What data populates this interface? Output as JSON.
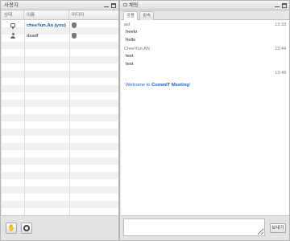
{
  "users_panel": {
    "title": "사용자",
    "columns": [
      "상태",
      "이름",
      "미디어"
    ],
    "users": [
      {
        "name": "cheeYun.An (you)",
        "status_icon": "monitor-icon",
        "media_icon": "shield-icon",
        "is_self": true
      },
      {
        "name": "daadf",
        "status_icon": "person-icon",
        "media_icon": "shield-icon",
        "is_self": false
      }
    ],
    "bottom_buttons": [
      {
        "icon": "hand-icon",
        "glyph": "✋"
      },
      {
        "icon": "gear-icon"
      }
    ]
  },
  "chat_panel": {
    "title": "채팅",
    "tabs": [
      {
        "label": "공용",
        "active": true
      },
      {
        "label": "귓속",
        "active": false
      }
    ],
    "messages": [
      {
        "sender": "asf",
        "time": "13:33",
        "lines": [
          "heelo",
          "hello"
        ]
      },
      {
        "sender": "CheeYun.AN",
        "time": "13:44",
        "lines": [
          "test",
          "test"
        ]
      },
      {
        "sender": "",
        "time": "13:48",
        "lines": []
      }
    ],
    "welcome": {
      "prefix": "Welcome to ",
      "app_name": "CommIT Meeting",
      "suffix": "!"
    },
    "input_value": "",
    "send_label": "보내기"
  },
  "colors": {
    "accent": "#1b5fc1",
    "self_user": "#1b4fa8"
  }
}
